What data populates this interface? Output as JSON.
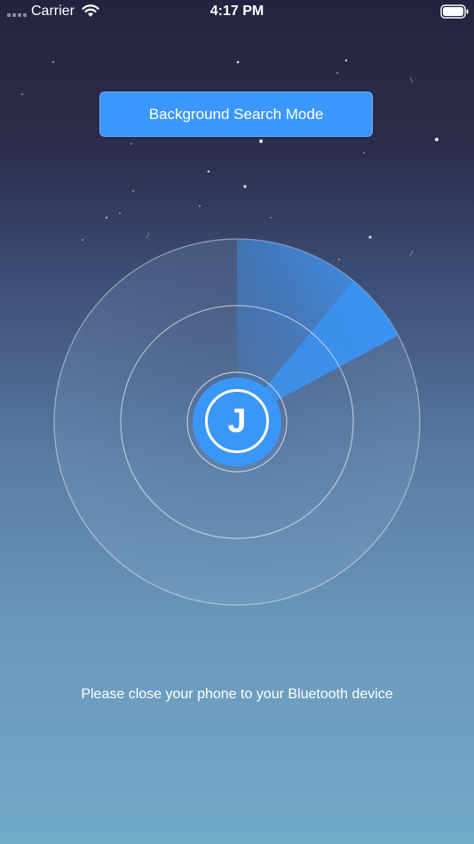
{
  "status_bar": {
    "carrier": "Carrier",
    "time": "4:17 PM",
    "signal_icon": "signal-dots-icon",
    "wifi_icon": "wifi-icon",
    "battery_icon": "battery-icon"
  },
  "main": {
    "mode_button_label": "Background Search Mode",
    "logo_letter": "J",
    "hint": "Please close your phone to your Bluetooth device"
  },
  "colors": {
    "accent": "#3b97fb",
    "sweep": "#3a96f8"
  }
}
